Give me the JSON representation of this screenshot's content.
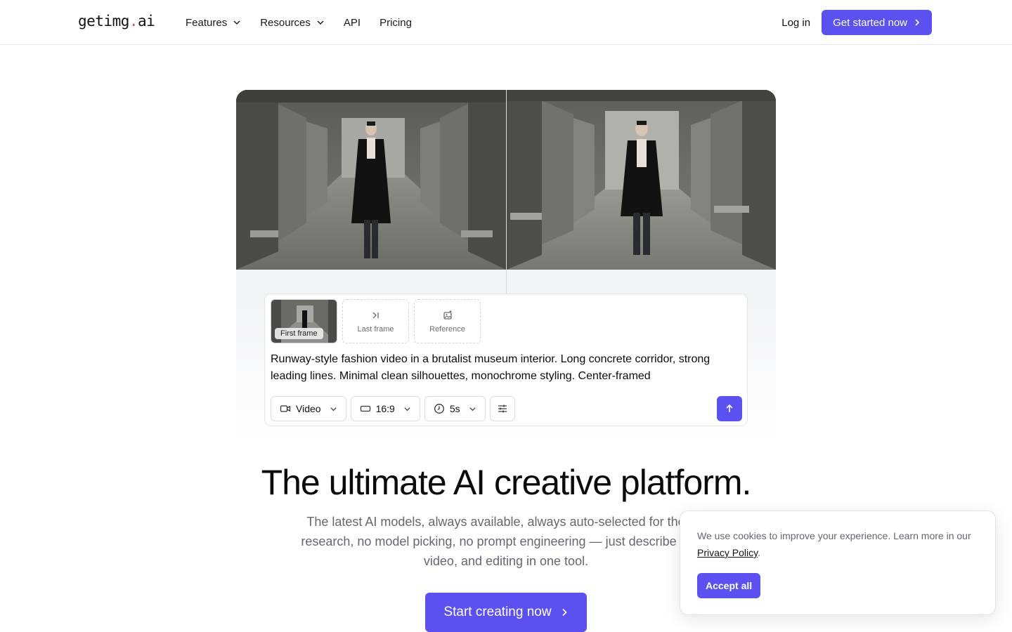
{
  "nav": {
    "logo_main": "getimg",
    "logo_dot": ".",
    "logo_tld": "ai",
    "links": [
      {
        "label": "Features",
        "dropdown": true
      },
      {
        "label": "Resources",
        "dropdown": true
      },
      {
        "label": "API",
        "dropdown": false
      },
      {
        "label": "Pricing",
        "dropdown": false
      }
    ],
    "login": "Log in",
    "cta": "Get started now"
  },
  "composer": {
    "frames": {
      "first": "First frame",
      "last": "Last frame",
      "reference": "Reference"
    },
    "prompt": "Runway-style fashion video in a brutalist museum interior. Long concrete corridor, strong leading lines. Minimal clean silhouettes, monochrome styling. Center-framed",
    "controls": {
      "mode": "Video",
      "aspect": "16:9",
      "duration": "5s"
    }
  },
  "hero": {
    "headline": "The ultimate AI creative platform.",
    "subline_1": "The latest AI models, always available, always auto-selected for the tas",
    "subline_2": "research, no model picking, no prompt engineering — just describe and c",
    "subline_3": "video, and editing in one tool.",
    "cta": "Start creating now"
  },
  "cookie": {
    "text_before": "We use cookies to improve your experience. Learn more in our ",
    "link": "Privacy Policy",
    "text_after": ".",
    "accept": "Accept all"
  },
  "colors": {
    "accent": "#5b50f0",
    "logo_dot": "#e5407a",
    "muted_text": "#666770"
  }
}
